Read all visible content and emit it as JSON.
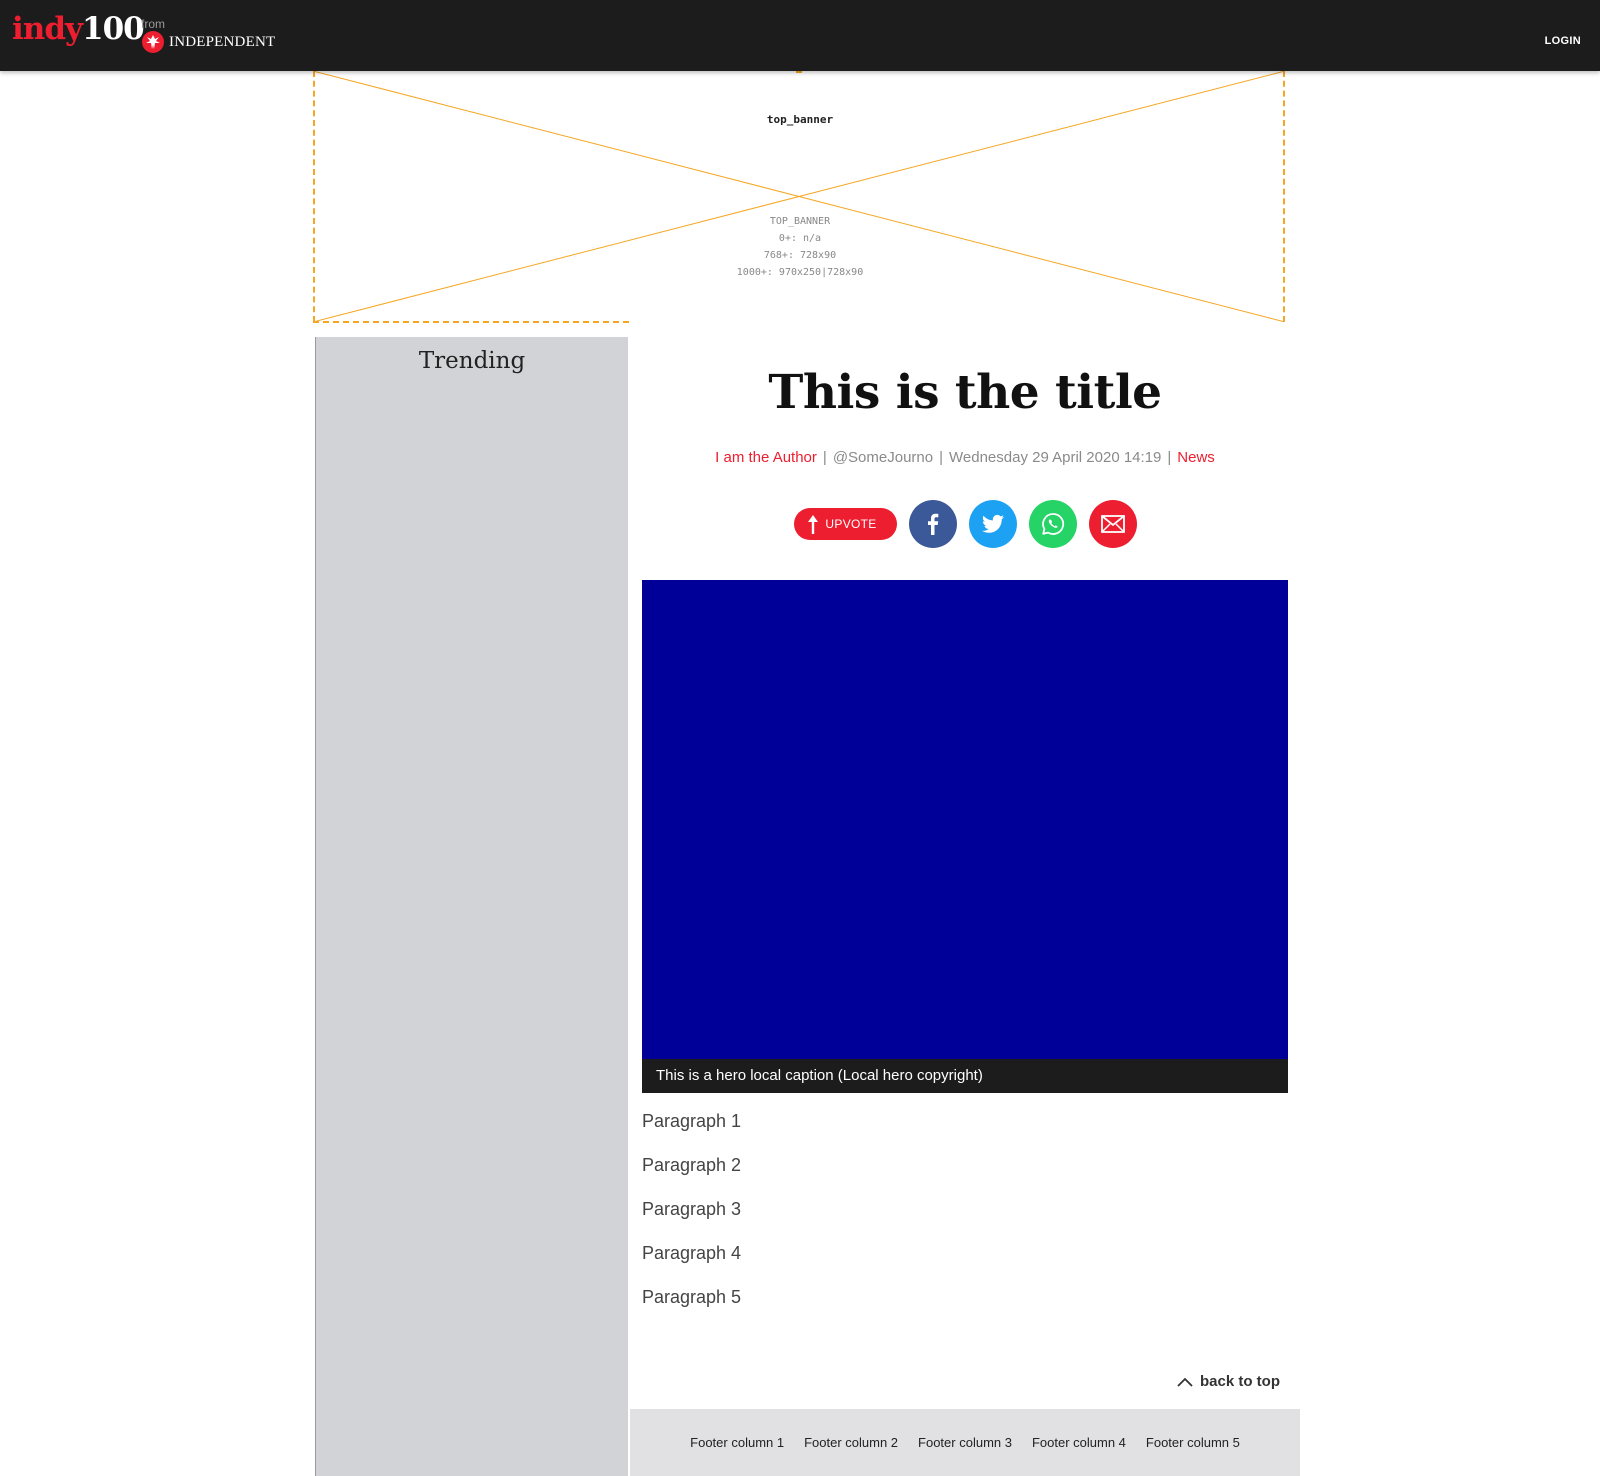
{
  "header": {
    "logo_word": "indy",
    "logo_number": "100",
    "from_label": "from",
    "publisher_name": "INDEPENDENT",
    "login_label": "LOGIN"
  },
  "ad_banner": {
    "slot_name": "top_banner",
    "size_lines": [
      "TOP_BANNER",
      "0+: n/a",
      "768+: 728x90",
      "1000+: 970x250|728x90"
    ]
  },
  "sidebar": {
    "title": "Trending"
  },
  "article": {
    "title": "This is the title",
    "author": "I am the Author",
    "twitter_handle": "@SomeJourno",
    "date": "Wednesday 29 April 2020 14:19",
    "section": "News",
    "hero_caption": "This is a hero local caption (Local hero copyright)",
    "paragraphs": [
      "Paragraph 1",
      "Paragraph 2",
      "Paragraph 3",
      "Paragraph 4",
      "Paragraph 5"
    ]
  },
  "share": {
    "upvote_label": "UPVOTE",
    "buttons": [
      {
        "network": "facebook",
        "icon": "facebook-icon",
        "color": "#3b5998"
      },
      {
        "network": "twitter",
        "icon": "twitter-icon",
        "color": "#1da1f2"
      },
      {
        "network": "whatsapp",
        "icon": "whatsapp-icon",
        "color": "#25d366"
      },
      {
        "network": "email",
        "icon": "email-icon",
        "color": "#ec1e2f"
      }
    ]
  },
  "back_to_top_label": "back to top",
  "footer": {
    "columns": [
      "Footer column 1",
      "Footer column 2",
      "Footer column 3",
      "Footer column 4",
      "Footer column 5"
    ]
  },
  "colors": {
    "brand_red": "#ec1e2f",
    "header_bg": "#1c1c1c",
    "ad_outline": "#f6a623",
    "hero_bg": "#000099",
    "sidebar_bg": "#d2d3d7",
    "footer_bg": "#e1e1e3"
  }
}
